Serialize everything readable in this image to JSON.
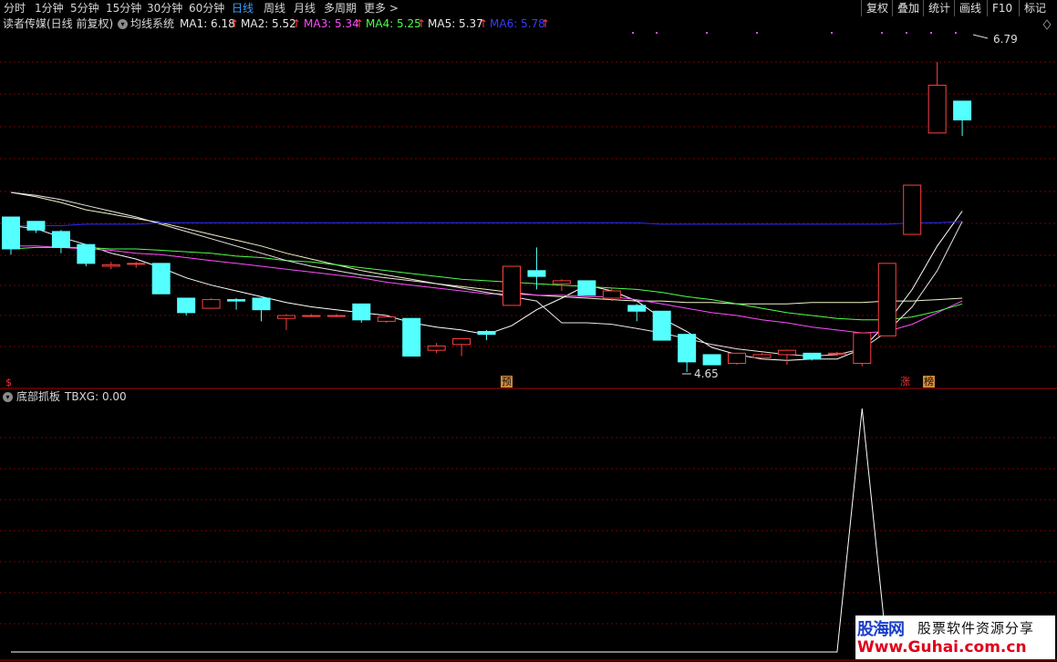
{
  "toolbar": {
    "periods": [
      {
        "label": "分时"
      },
      {
        "label": "1分钟"
      },
      {
        "label": "5分钟"
      },
      {
        "label": "15分钟"
      },
      {
        "label": "30分钟"
      },
      {
        "label": "60分钟"
      },
      {
        "label": "日线",
        "active": true
      },
      {
        "label": "周线"
      },
      {
        "label": "月线"
      },
      {
        "label": "多周期"
      },
      {
        "label": "更多 >"
      }
    ],
    "right_buttons": [
      "复权",
      "叠加",
      "统计",
      "画线",
      "F10",
      "标记"
    ]
  },
  "main_panel": {
    "stock_name": "读者传媒(日线 前复权)",
    "indicator_name": "均线系统",
    "ma": [
      {
        "label": "MA1: 6.18",
        "color": "#e8e8e8",
        "arrow": "up"
      },
      {
        "label": "MA2: 5.52",
        "color": "#e8e8e8",
        "arrow": "up"
      },
      {
        "label": "MA3: 5.34",
        "color": "#ff4dff",
        "arrow": "up"
      },
      {
        "label": "MA4: 5.25",
        "color": "#4dff4d",
        "arrow": "up"
      },
      {
        "label": "MA5: 5.37",
        "color": "#e8e8e8",
        "arrow": "up"
      },
      {
        "label": "MA6: 5.78",
        "color": "#3a3aff",
        "arrow": "up"
      }
    ],
    "high_label": "6.79",
    "low_label": "4.65",
    "markers": [
      {
        "text": "$",
        "color": "#ff3030",
        "bg": "none"
      },
      {
        "text": "预",
        "color": "#111",
        "bg": "#d28a3c"
      },
      {
        "text": "涨",
        "color": "#ff3030",
        "bg": "none"
      },
      {
        "text": "榜",
        "color": "#111",
        "bg": "#d28a3c"
      }
    ],
    "colors": {
      "up": "#ff4040",
      "down": "#54ffff",
      "grid": "#7a0000"
    }
  },
  "indicator_panel": {
    "name": "底部抓板",
    "value_label": "TBXG: 0.00"
  },
  "chart_data": {
    "type": "candlestick",
    "price_range": [
      4.65,
      6.79
    ],
    "candles": [
      {
        "o": 5.72,
        "h": 5.72,
        "l": 5.46,
        "c": 5.5
      },
      {
        "o": 5.69,
        "h": 5.69,
        "l": 5.61,
        "c": 5.63
      },
      {
        "o": 5.62,
        "h": 5.63,
        "l": 5.47,
        "c": 5.51
      },
      {
        "o": 5.53,
        "h": 5.53,
        "l": 5.38,
        "c": 5.4
      },
      {
        "o": 5.38,
        "h": 5.41,
        "l": 5.36,
        "c": 5.39
      },
      {
        "o": 5.4,
        "h": 5.41,
        "l": 5.37,
        "c": 5.4
      },
      {
        "o": 5.4,
        "h": 5.4,
        "l": 5.19,
        "c": 5.19
      },
      {
        "o": 5.16,
        "h": 5.16,
        "l": 5.04,
        "c": 5.06
      },
      {
        "o": 5.09,
        "h": 5.16,
        "l": 5.09,
        "c": 5.15
      },
      {
        "o": 5.15,
        "h": 5.16,
        "l": 5.08,
        "c": 5.14
      },
      {
        "o": 5.16,
        "h": 5.16,
        "l": 5.0,
        "c": 5.08
      },
      {
        "o": 5.02,
        "h": 5.05,
        "l": 4.94,
        "c": 5.04
      },
      {
        "o": 5.04,
        "h": 5.05,
        "l": 5.03,
        "c": 5.04
      },
      {
        "o": 5.04,
        "h": 5.05,
        "l": 5.03,
        "c": 5.04
      },
      {
        "o": 5.12,
        "h": 5.12,
        "l": 4.99,
        "c": 5.01
      },
      {
        "o": 5.0,
        "h": 5.03,
        "l": 4.99,
        "c": 5.03
      },
      {
        "o": 5.02,
        "h": 5.02,
        "l": 4.76,
        "c": 4.76
      },
      {
        "o": 4.8,
        "h": 4.85,
        "l": 4.78,
        "c": 4.83
      },
      {
        "o": 4.84,
        "h": 4.88,
        "l": 4.76,
        "c": 4.88
      },
      {
        "o": 4.93,
        "h": 4.94,
        "l": 4.87,
        "c": 4.91
      },
      {
        "o": 5.11,
        "h": 5.38,
        "l": 5.11,
        "c": 5.38
      },
      {
        "o": 5.35,
        "h": 5.51,
        "l": 5.22,
        "c": 5.31
      },
      {
        "o": 5.26,
        "h": 5.29,
        "l": 5.21,
        "c": 5.28
      },
      {
        "o": 5.28,
        "h": 5.28,
        "l": 5.18,
        "c": 5.18
      },
      {
        "o": 5.16,
        "h": 5.23,
        "l": 5.14,
        "c": 5.21
      },
      {
        "o": 5.11,
        "h": 5.12,
        "l": 5.0,
        "c": 5.07
      },
      {
        "o": 5.07,
        "h": 5.07,
        "l": 4.87,
        "c": 4.87
      },
      {
        "o": 4.91,
        "h": 4.91,
        "l": 4.65,
        "c": 4.72
      },
      {
        "o": 4.77,
        "h": 4.77,
        "l": 4.73,
        "c": 4.7
      },
      {
        "o": 4.71,
        "h": 4.78,
        "l": 4.7,
        "c": 4.78
      },
      {
        "o": 4.75,
        "h": 4.78,
        "l": 4.75,
        "c": 4.77
      },
      {
        "o": 4.77,
        "h": 4.8,
        "l": 4.7,
        "c": 4.8
      },
      {
        "o": 4.78,
        "h": 4.78,
        "l": 4.73,
        "c": 4.74
      },
      {
        "o": 4.78,
        "h": 4.79,
        "l": 4.76,
        "c": 4.78
      },
      {
        "o": 4.71,
        "h": 4.92,
        "l": 4.69,
        "c": 4.92
      },
      {
        "o": 4.9,
        "h": 5.4,
        "l": 4.9,
        "c": 5.4
      },
      {
        "o": 5.6,
        "h": 5.94,
        "l": 5.6,
        "c": 5.94
      },
      {
        "o": 6.3,
        "h": 6.79,
        "l": 6.3,
        "c": 6.63
      },
      {
        "o": 6.52,
        "h": 6.52,
        "l": 6.28,
        "c": 6.39
      }
    ],
    "ma_lines": [
      {
        "name": "MA1",
        "color": "#f2f2c8",
        "values": [
          5.89,
          5.86,
          5.82,
          5.77,
          5.74,
          5.71,
          5.68,
          5.64,
          5.6,
          5.56,
          5.52,
          5.47,
          5.43,
          5.39,
          5.35,
          5.32,
          5.29,
          5.26,
          5.24,
          5.22,
          5.2,
          5.18,
          5.17,
          5.16,
          5.15,
          5.14,
          5.14,
          5.13,
          5.13,
          5.12,
          5.12,
          5.12,
          5.13,
          5.13,
          5.13,
          5.14,
          5.14,
          5.15,
          5.16
        ]
      },
      {
        "name": "MA2",
        "color": "#ffffff",
        "values": [
          5.66,
          5.64,
          5.58,
          5.53,
          5.47,
          5.43,
          5.37,
          5.3,
          5.25,
          5.21,
          5.17,
          5.13,
          5.1,
          5.08,
          5.06,
          5.04,
          4.99,
          4.96,
          4.94,
          4.91,
          4.97,
          5.08,
          5.16,
          5.25,
          5.21,
          5.14,
          5.02,
          4.93,
          4.82,
          4.77,
          4.74,
          4.73,
          4.74,
          4.74,
          4.81,
          4.99,
          5.22,
          5.52,
          5.76
        ]
      },
      {
        "name": "MA3",
        "color": "#ff4dff",
        "values": [
          5.52,
          5.52,
          5.51,
          5.5,
          5.49,
          5.47,
          5.46,
          5.44,
          5.42,
          5.4,
          5.38,
          5.36,
          5.34,
          5.32,
          5.3,
          5.27,
          5.25,
          5.23,
          5.21,
          5.19,
          5.19,
          5.18,
          5.18,
          5.17,
          5.17,
          5.15,
          5.12,
          5.09,
          5.06,
          5.04,
          5.01,
          4.99,
          4.96,
          4.94,
          4.92,
          4.93,
          4.98,
          5.06,
          5.14
        ]
      },
      {
        "name": "MA4",
        "color": "#4dff4d",
        "values": [
          5.5,
          5.51,
          5.51,
          5.51,
          5.5,
          5.5,
          5.49,
          5.48,
          5.47,
          5.45,
          5.44,
          5.42,
          5.41,
          5.39,
          5.37,
          5.35,
          5.33,
          5.31,
          5.29,
          5.28,
          5.27,
          5.26,
          5.25,
          5.24,
          5.23,
          5.22,
          5.2,
          5.17,
          5.15,
          5.12,
          5.09,
          5.06,
          5.04,
          5.02,
          5.01,
          5.01,
          5.03,
          5.07,
          5.12
        ]
      },
      {
        "name": "MA5",
        "color": "#e8e8e8",
        "values": [
          5.89,
          5.87,
          5.84,
          5.8,
          5.76,
          5.72,
          5.67,
          5.62,
          5.57,
          5.52,
          5.47,
          5.42,
          5.38,
          5.35,
          5.32,
          5.3,
          5.28,
          5.26,
          5.23,
          5.2,
          5.17,
          5.14,
          4.99,
          4.99,
          4.98,
          4.95,
          4.92,
          4.88,
          4.84,
          4.81,
          4.79,
          4.77,
          4.76,
          4.77,
          4.81,
          4.93,
          5.1,
          5.35,
          5.69
        ]
      },
      {
        "name": "MA6",
        "color": "#2a2aff",
        "values": [
          5.66,
          5.66,
          5.66,
          5.67,
          5.67,
          5.67,
          5.68,
          5.68,
          5.68,
          5.68,
          5.68,
          5.68,
          5.68,
          5.68,
          5.68,
          5.68,
          5.68,
          5.68,
          5.68,
          5.68,
          5.68,
          5.68,
          5.68,
          5.68,
          5.68,
          5.68,
          5.67,
          5.67,
          5.67,
          5.67,
          5.67,
          5.67,
          5.67,
          5.67,
          5.67,
          5.67,
          5.68,
          5.68,
          5.69
        ]
      }
    ],
    "tbxg": [
      0,
      0,
      0,
      0,
      0,
      0,
      0,
      0,
      0,
      0,
      0,
      0,
      0,
      0,
      0,
      0,
      0,
      0,
      0,
      0,
      0,
      0,
      0,
      0,
      0,
      0,
      0,
      0,
      0,
      0,
      0,
      0,
      0,
      0,
      1,
      0,
      0,
      0,
      0
    ]
  },
  "watermark": {
    "logo": "股海网",
    "text": "股票软件资源分享",
    "url": "Www.Guhai.com.cn"
  }
}
